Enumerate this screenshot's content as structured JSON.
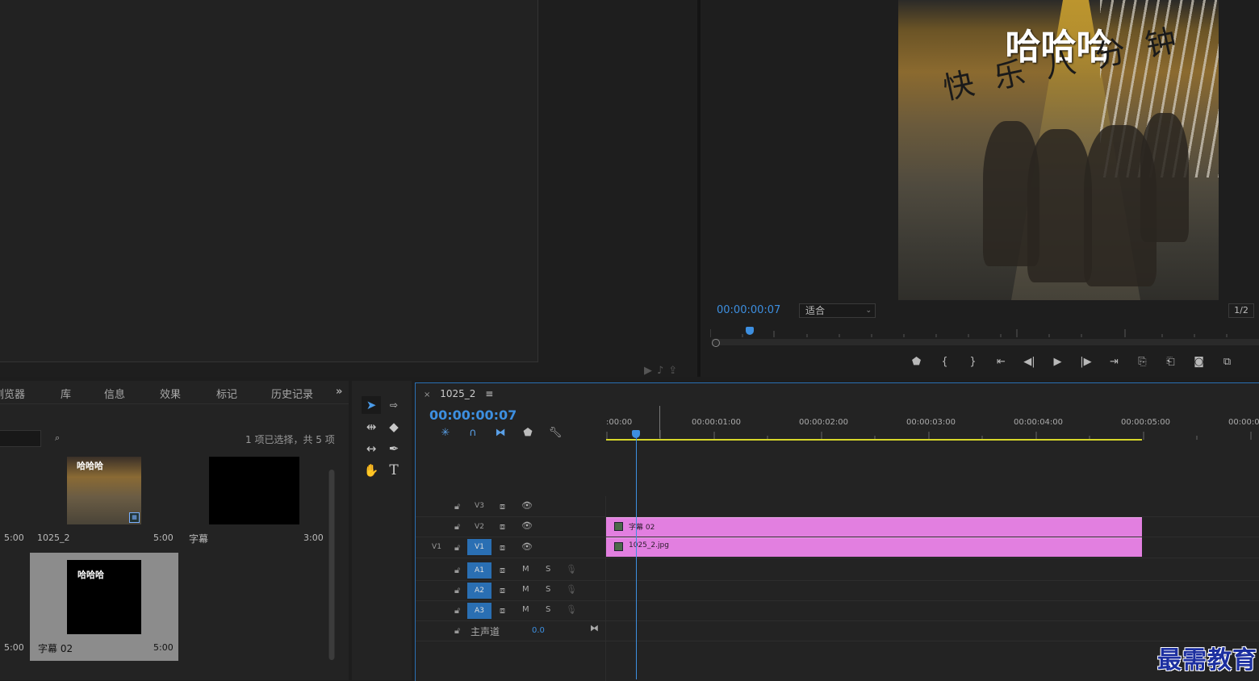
{
  "program": {
    "video_title": "哈哈哈",
    "video_subtitle": "快乐八分钟",
    "timecode": "00:00:00:07",
    "fit_value": "适合",
    "resolution": "1/2"
  },
  "project": {
    "tabs": [
      "浏览器",
      "库",
      "信息",
      "效果",
      "标记",
      "历史记录"
    ],
    "overflow": "»",
    "selection_count": "1 项已选择，共 5 项",
    "items": [
      {
        "left_dur": "5:00",
        "name": "1025_2",
        "dur": "5:00"
      },
      {
        "name": "字幕",
        "dur": "3:00"
      },
      {
        "left_dur": "5:00",
        "name": "字幕 02",
        "dur": "5:00",
        "thumb_text": "哈哈哈"
      }
    ],
    "thumb1_text": "哈哈哈"
  },
  "timeline": {
    "tab_close": "×",
    "tab_name": "1025_2",
    "tab_menu": "≡",
    "timecode": "00:00:00:07",
    "ruler": [
      ":00:00",
      "00:00:01:00",
      "00:00:02:00",
      "00:00:03:00",
      "00:00:04:00",
      "00:00:05:00",
      "00:00:0"
    ],
    "tracks": {
      "v3": "V3",
      "v2": "V2",
      "v1": "V1",
      "v1_src": "V1",
      "a1": "A1",
      "a2": "A2",
      "a3": "A3",
      "mute": "M",
      "solo": "S",
      "master": "主声道",
      "master_value": "0.0"
    },
    "clips": {
      "subtitle": "字幕 02",
      "image": "1025_2.jpg"
    }
  },
  "watermark": "最需教育",
  "colors": {
    "accent_blue": "#3d8fe0",
    "clip_pink": "#e27fe0",
    "work_area_yellow": "#d6d62a"
  }
}
